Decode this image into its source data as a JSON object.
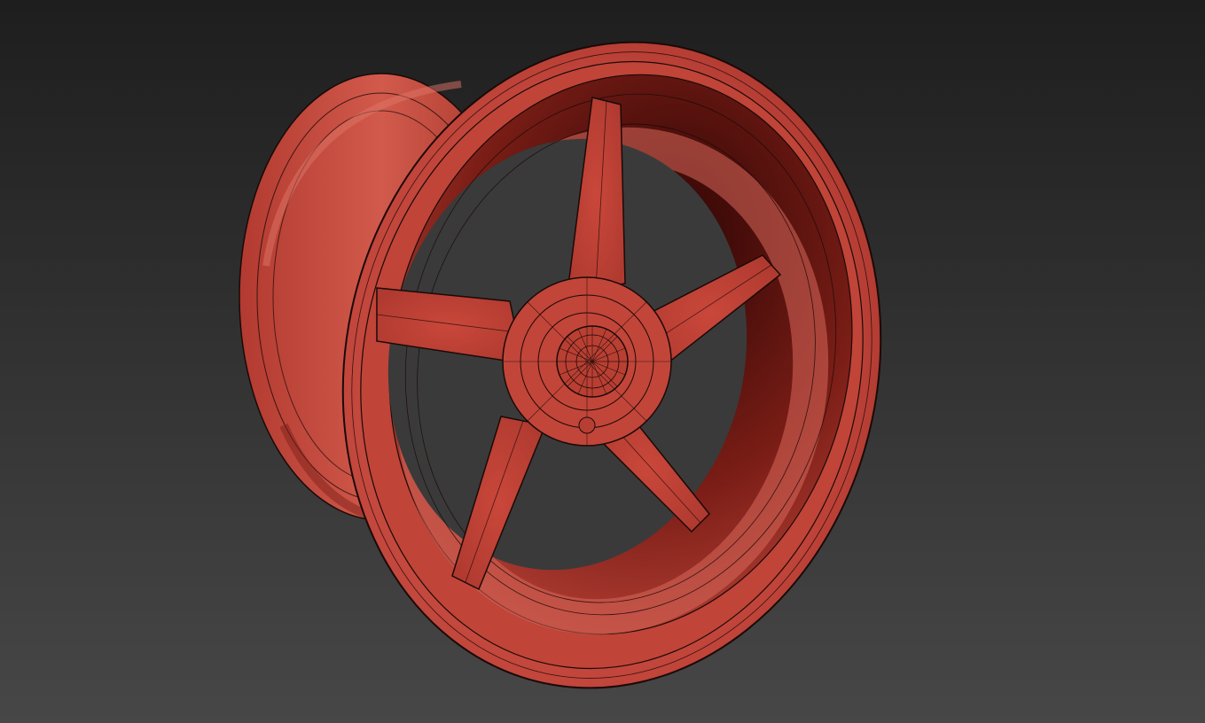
{
  "viewport": {
    "background_top": "#1e1e1e",
    "background_bottom": "#474747"
  },
  "model": {
    "object": "wheel-rim-wireframe",
    "shading": "smooth-with-edged-faces",
    "color": "#c9473a",
    "color_dark": "#4a0c08",
    "color_light": "#d9655a",
    "edge_color": "#1a0a08",
    "spoke_count": 5
  }
}
